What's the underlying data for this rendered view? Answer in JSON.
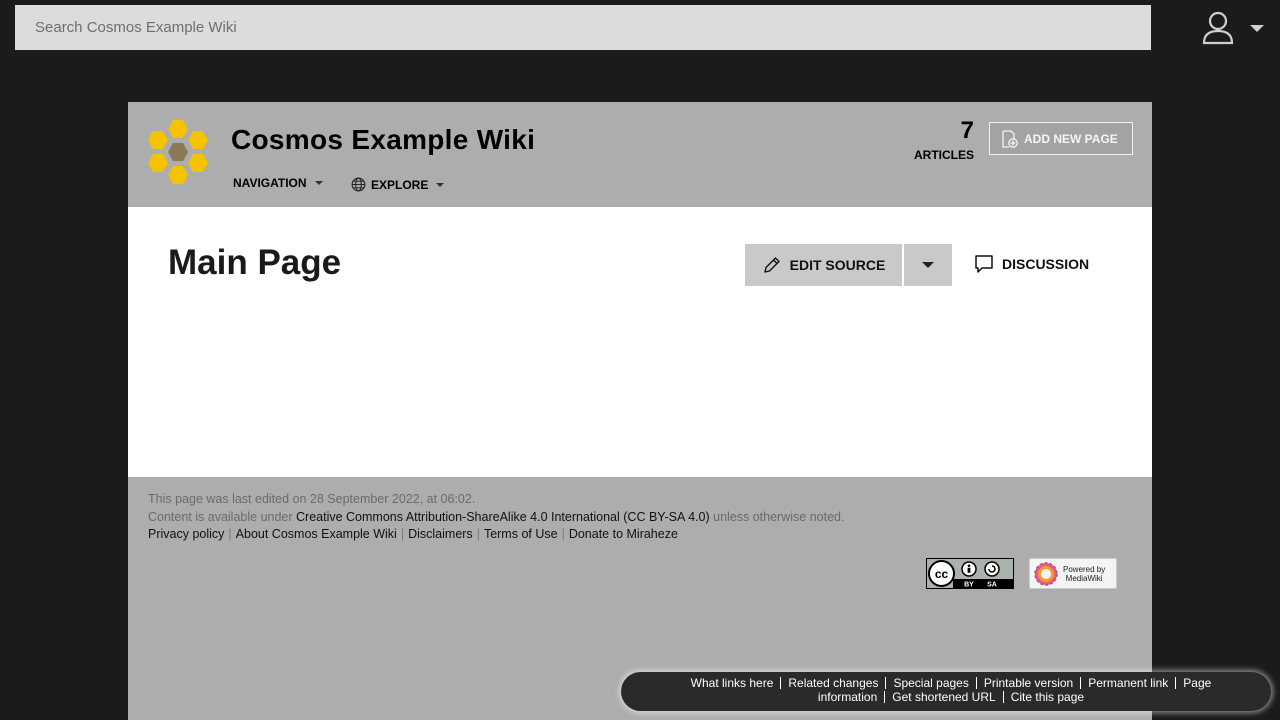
{
  "search": {
    "placeholder": "Search Cosmos Example Wiki"
  },
  "header": {
    "site_title": "Cosmos Example Wiki",
    "nav": {
      "navigation_label": "NAVIGATION",
      "explore_label": "EXPLORE"
    },
    "articles": {
      "count": "7",
      "label": "ARTICLES"
    },
    "add_page_label": "ADD NEW PAGE"
  },
  "content": {
    "page_title": "Main Page",
    "edit_source_label": "EDIT SOURCE",
    "discussion_label": "DISCUSSION"
  },
  "footer": {
    "last_edited": "This page was last edited on 28 September 2022, at 06:02.",
    "license_prefix": "Content is available under ",
    "license_link": "Creative Commons Attribution-ShareAlike 4.0 International (CC BY-SA 4.0)",
    "license_suffix": " unless otherwise noted.",
    "links": [
      "Privacy policy",
      "About Cosmos Example Wiki",
      "Disclaimers",
      "Terms of Use",
      "Donate to Miraheze"
    ],
    "mediawiki_badge": {
      "line1": "Powered by",
      "line2": "MediaWiki"
    },
    "cc_badge": {
      "by": "BY",
      "sa": "SA"
    }
  },
  "tools": [
    "What links here",
    "Related changes",
    "Special pages",
    "Printable version",
    "Permanent link",
    "Page information",
    "Get shortened URL",
    "Cite this page"
  ],
  "colors": {
    "logo_yellow": "#f5c200",
    "logo_center": "#8b7a55",
    "page_bg": "#1b1b1b",
    "wiki_bg": "#adadad"
  },
  "icons": [
    "user-icon",
    "globe-icon",
    "add-page-icon",
    "pencil-icon",
    "speech-bubble-icon",
    "cc-logo-icon",
    "mediawiki-flower-icon"
  ]
}
